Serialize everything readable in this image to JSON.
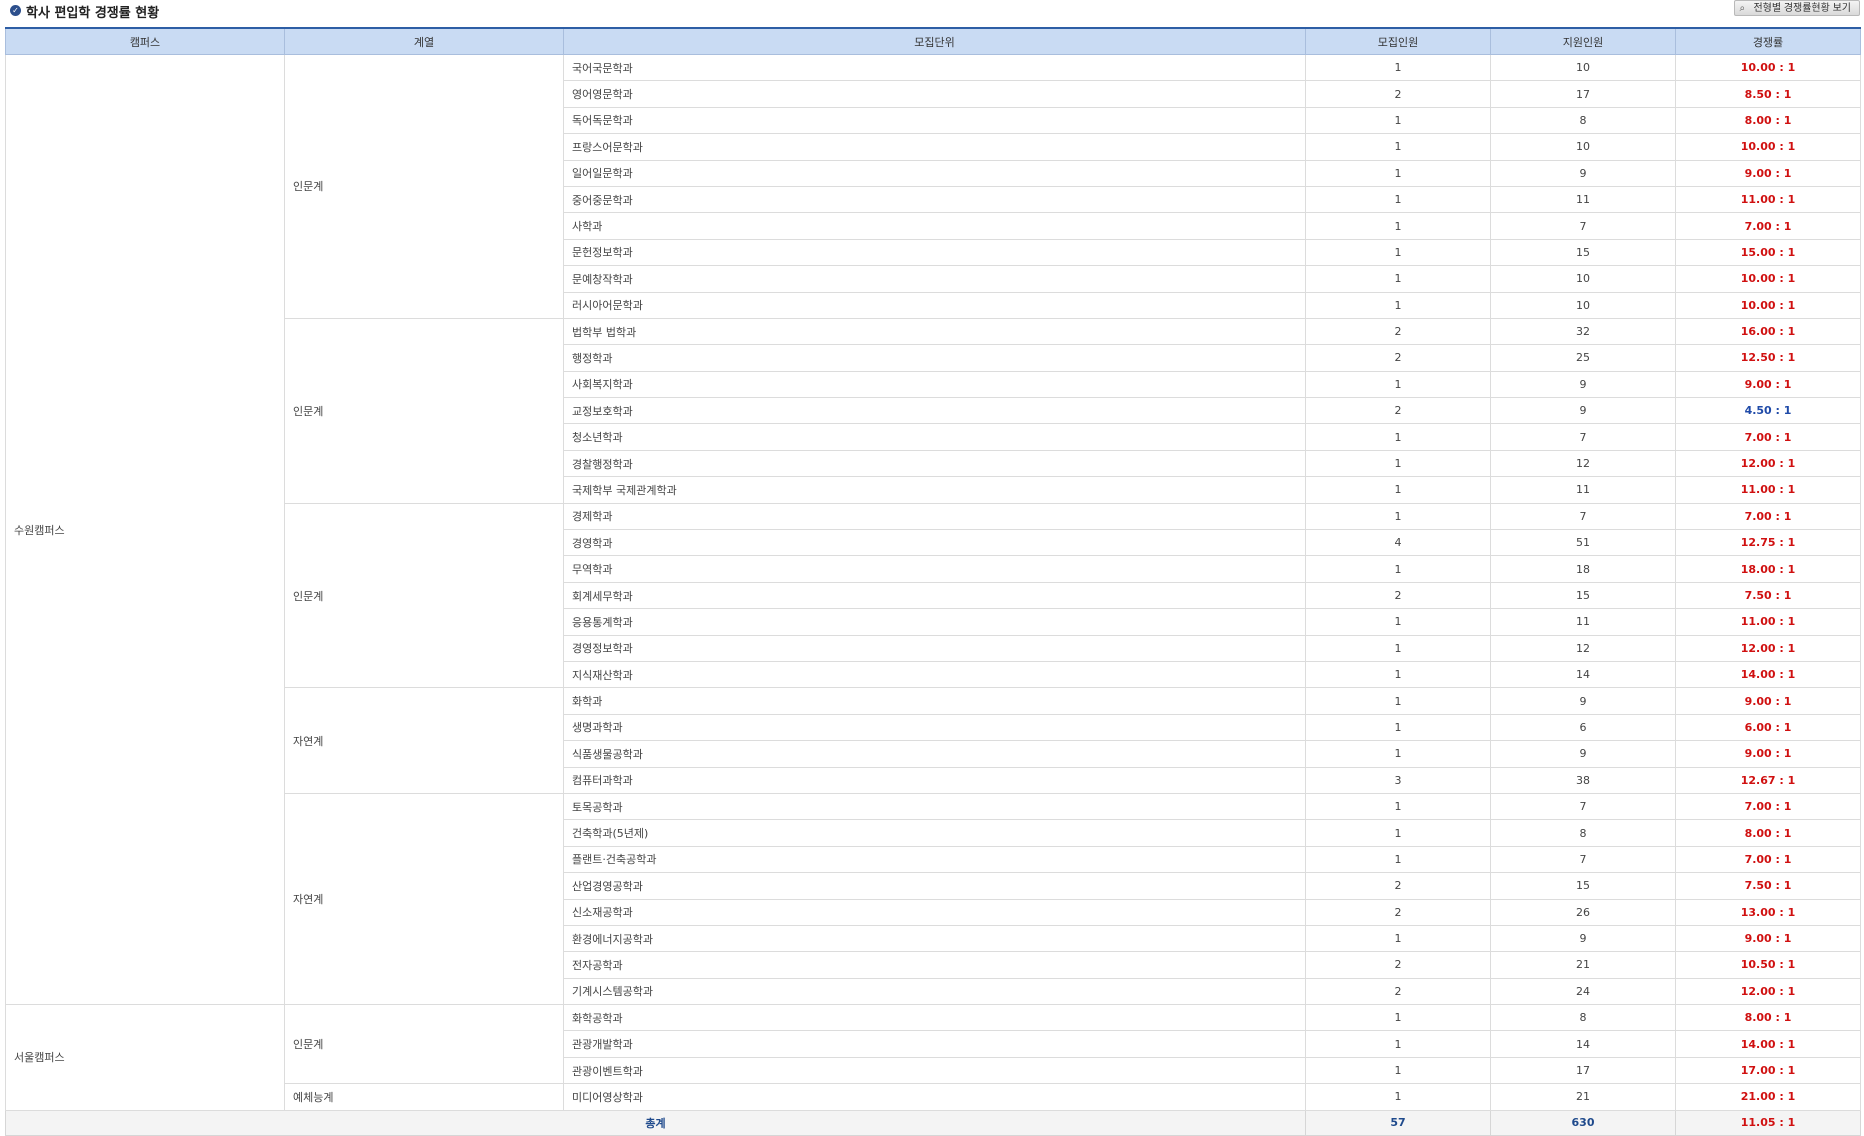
{
  "title": "학사 편입학 경쟁률 현황",
  "view_button_label": "전형별 경쟁률현황 보기",
  "columns": [
    "캠퍼스",
    "계열",
    "모집단위",
    "모집인원",
    "지원인원",
    "경쟁률"
  ],
  "campuses": [
    "수원캠퍼스",
    "서울캠퍼스"
  ],
  "series_labels": [
    "인문계",
    "인문계",
    "인문계",
    "자연계",
    "자연계",
    "인문계",
    "예체능계"
  ],
  "rows": [
    {
      "unit": "국어국문학과",
      "quota": "1",
      "applicants": "10",
      "rate": "10.00 : 1"
    },
    {
      "unit": "영어영문학과",
      "quota": "2",
      "applicants": "17",
      "rate": "8.50 : 1"
    },
    {
      "unit": "독어독문학과",
      "quota": "1",
      "applicants": "8",
      "rate": "8.00 : 1"
    },
    {
      "unit": "프랑스어문학과",
      "quota": "1",
      "applicants": "10",
      "rate": "10.00 : 1"
    },
    {
      "unit": "일어일문학과",
      "quota": "1",
      "applicants": "9",
      "rate": "9.00 : 1"
    },
    {
      "unit": "중어중문학과",
      "quota": "1",
      "applicants": "11",
      "rate": "11.00 : 1"
    },
    {
      "unit": "사학과",
      "quota": "1",
      "applicants": "7",
      "rate": "7.00 : 1"
    },
    {
      "unit": "문헌정보학과",
      "quota": "1",
      "applicants": "15",
      "rate": "15.00 : 1"
    },
    {
      "unit": "문예창작학과",
      "quota": "1",
      "applicants": "10",
      "rate": "10.00 : 1"
    },
    {
      "unit": "러시아어문학과",
      "quota": "1",
      "applicants": "10",
      "rate": "10.00 : 1"
    },
    {
      "unit": "법학부 법학과",
      "quota": "2",
      "applicants": "32",
      "rate": "16.00 : 1"
    },
    {
      "unit": "행정학과",
      "quota": "2",
      "applicants": "25",
      "rate": "12.50 : 1"
    },
    {
      "unit": "사회복지학과",
      "quota": "1",
      "applicants": "9",
      "rate": "9.00 : 1"
    },
    {
      "unit": "교정보호학과",
      "quota": "2",
      "applicants": "9",
      "rate": "4.50 : 1"
    },
    {
      "unit": "청소년학과",
      "quota": "1",
      "applicants": "7",
      "rate": "7.00 : 1"
    },
    {
      "unit": "경찰행정학과",
      "quota": "1",
      "applicants": "12",
      "rate": "12.00 : 1"
    },
    {
      "unit": "국제학부 국제관계학과",
      "quota": "1",
      "applicants": "11",
      "rate": "11.00 : 1"
    },
    {
      "unit": "경제학과",
      "quota": "1",
      "applicants": "7",
      "rate": "7.00 : 1"
    },
    {
      "unit": "경영학과",
      "quota": "4",
      "applicants": "51",
      "rate": "12.75 : 1"
    },
    {
      "unit": "무역학과",
      "quota": "1",
      "applicants": "18",
      "rate": "18.00 : 1"
    },
    {
      "unit": "회계세무학과",
      "quota": "2",
      "applicants": "15",
      "rate": "7.50 : 1"
    },
    {
      "unit": "응용통계학과",
      "quota": "1",
      "applicants": "11",
      "rate": "11.00 : 1"
    },
    {
      "unit": "경영정보학과",
      "quota": "1",
      "applicants": "12",
      "rate": "12.00 : 1"
    },
    {
      "unit": "지식재산학과",
      "quota": "1",
      "applicants": "14",
      "rate": "14.00 : 1"
    },
    {
      "unit": "화학과",
      "quota": "1",
      "applicants": "9",
      "rate": "9.00 : 1"
    },
    {
      "unit": "생명과학과",
      "quota": "1",
      "applicants": "6",
      "rate": "6.00 : 1"
    },
    {
      "unit": "식품생물공학과",
      "quota": "1",
      "applicants": "9",
      "rate": "9.00 : 1"
    },
    {
      "unit": "컴퓨터과학과",
      "quota": "3",
      "applicants": "38",
      "rate": "12.67 : 1"
    },
    {
      "unit": "토목공학과",
      "quota": "1",
      "applicants": "7",
      "rate": "7.00 : 1"
    },
    {
      "unit": "건축학과(5년제)",
      "quota": "1",
      "applicants": "8",
      "rate": "8.00 : 1"
    },
    {
      "unit": "플랜트·건축공학과",
      "quota": "1",
      "applicants": "7",
      "rate": "7.00 : 1"
    },
    {
      "unit": "산업경영공학과",
      "quota": "2",
      "applicants": "15",
      "rate": "7.50 : 1"
    },
    {
      "unit": "신소재공학과",
      "quota": "2",
      "applicants": "26",
      "rate": "13.00 : 1"
    },
    {
      "unit": "환경에너지공학과",
      "quota": "1",
      "applicants": "9",
      "rate": "9.00 : 1"
    },
    {
      "unit": "전자공학과",
      "quota": "2",
      "applicants": "21",
      "rate": "10.50 : 1"
    },
    {
      "unit": "기계시스템공학과",
      "quota": "2",
      "applicants": "24",
      "rate": "12.00 : 1"
    },
    {
      "unit": "화학공학과",
      "quota": "1",
      "applicants": "8",
      "rate": "8.00 : 1"
    },
    {
      "unit": "관광개발학과",
      "quota": "1",
      "applicants": "14",
      "rate": "14.00 : 1"
    },
    {
      "unit": "관광이벤트학과",
      "quota": "1",
      "applicants": "17",
      "rate": "17.00 : 1"
    },
    {
      "unit": "미디어영상학과",
      "quota": "1",
      "applicants": "21",
      "rate": "21.00 : 1"
    }
  ],
  "total": {
    "label": "총계",
    "quota": "57",
    "applicants": "630",
    "rate": "11.05 : 1"
  },
  "colors": {
    "header_bg": "#c9dbf3",
    "rate_high": "#d01010",
    "rate_low": "#1f4aa8"
  }
}
